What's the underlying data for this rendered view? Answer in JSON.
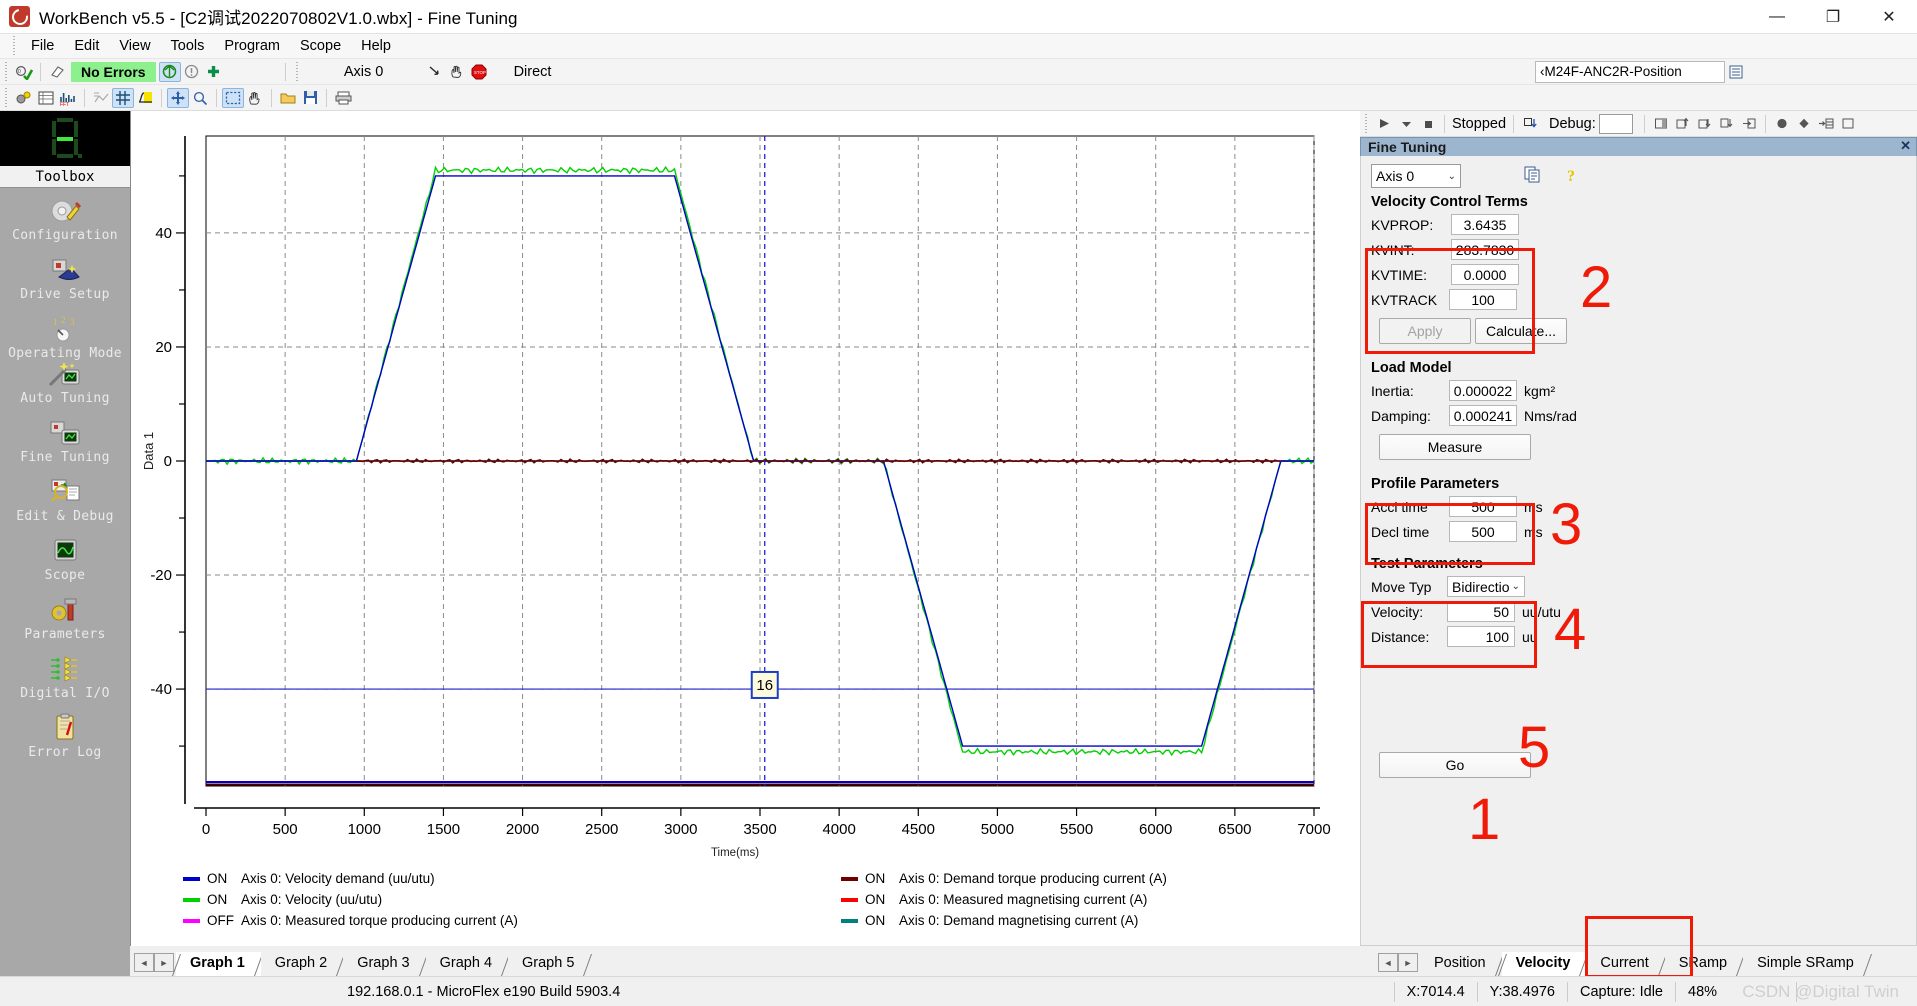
{
  "window": {
    "title": "WorkBench v5.5 - [C2调试2022070802V1.0.wbx] - Fine Tuning",
    "logo": "workbench-logo",
    "minimize": "—",
    "maximize": "❐",
    "close": "✕"
  },
  "menu": {
    "items": [
      "File",
      "Edit",
      "View",
      "Tools",
      "Program",
      "Scope",
      "Help"
    ]
  },
  "toolbar1": {
    "status_text": "No Errors",
    "axis_label": "Axis 0",
    "mode_label": "Direct",
    "config_value": "‹M24F-ANC2R-Position"
  },
  "debugbar": {
    "run_state": "Stopped",
    "debug_label": "Debug:"
  },
  "toolbox": {
    "title": "Toolbox",
    "items": [
      {
        "label": "Configuration",
        "icon": "gear-pencil-icon"
      },
      {
        "label": "Drive Setup",
        "icon": "wizard-hat-icon"
      },
      {
        "label": "Operating Mode",
        "icon": "numbers-dial-icon"
      },
      {
        "label": "Auto Tuning",
        "icon": "magic-wand-icon"
      },
      {
        "label": "Fine Tuning",
        "icon": "tuning-screen-icon"
      },
      {
        "label": "Edit & Debug",
        "icon": "magnifier-doc-icon"
      },
      {
        "label": "Scope",
        "icon": "oscilloscope-icon"
      },
      {
        "label": "Parameters",
        "icon": "hammer-gear-icon"
      },
      {
        "label": "Digital I/O",
        "icon": "io-signals-icon"
      },
      {
        "label": "Error Log",
        "icon": "clipboard-error-icon"
      }
    ]
  },
  "chart_data": {
    "type": "line",
    "title": "",
    "xlabel": "Time(ms)",
    "ylabel": "Data 1",
    "xlim": [
      0,
      7000
    ],
    "ylim": [
      -57,
      57
    ],
    "xticks": [
      0,
      500,
      1000,
      1500,
      2000,
      2500,
      3000,
      3500,
      4000,
      4500,
      5000,
      5500,
      6000,
      6500,
      7000
    ],
    "yticks": [
      40,
      20,
      0,
      -20,
      -40
    ],
    "grid": true,
    "legend_position": "bottom",
    "cursor": {
      "label": "16",
      "x": 3530
    },
    "threshold_line": {
      "value": -40,
      "color": "#2222cc"
    },
    "series": [
      {
        "name": "Axis 0: Velocity demand (uu/utu)",
        "state": "ON",
        "color": "#0000cc",
        "points": [
          [
            0,
            0
          ],
          [
            950,
            0
          ],
          [
            1450,
            50
          ],
          [
            2960,
            50
          ],
          [
            3460,
            0
          ],
          [
            4280,
            0
          ],
          [
            4780,
            -50
          ],
          [
            6290,
            -50
          ],
          [
            6790,
            0
          ],
          [
            7000,
            0
          ]
        ]
      },
      {
        "name": "Axis 0: Velocity (uu/utu)",
        "state": "ON",
        "color": "#00d000",
        "points": [
          [
            0,
            0
          ],
          [
            950,
            0
          ],
          [
            1450,
            51
          ],
          [
            2960,
            51
          ],
          [
            3460,
            0
          ],
          [
            4280,
            0
          ],
          [
            4780,
            -51
          ],
          [
            6290,
            -51
          ],
          [
            6790,
            0
          ],
          [
            7000,
            0
          ]
        ]
      },
      {
        "name": "Axis 0: Measured torque producing current (A)",
        "state": "OFF",
        "color": "#ff00ff",
        "points": []
      },
      {
        "name": "Axis 0: Demand torque producing current (A)",
        "state": "ON",
        "color": "#6e0000",
        "points": [
          [
            950,
            0
          ],
          [
            3460,
            0
          ],
          [
            4280,
            0
          ],
          [
            6790,
            0
          ]
        ]
      },
      {
        "name": "Axis 0: Measured magnetising current (A)",
        "state": "ON",
        "color": "#ff0000",
        "points": [
          [
            950,
            0
          ],
          [
            3460,
            0
          ],
          [
            4280,
            0
          ],
          [
            6790,
            0
          ]
        ]
      },
      {
        "name": "Axis 0: Demand magnetising current (A)",
        "state": "ON",
        "color": "#008080",
        "points": [
          [
            950,
            0
          ],
          [
            3460,
            0
          ],
          [
            4280,
            0
          ],
          [
            6790,
            0
          ]
        ]
      }
    ]
  },
  "graph_tabs": {
    "items": [
      "Graph 1",
      "Graph 2",
      "Graph 3",
      "Graph 4",
      "Graph 5"
    ],
    "selected": "Graph 1",
    "prev": "◄",
    "next": "►"
  },
  "fine_tuning": {
    "panel_title": "Fine Tuning",
    "panel_close": "✕",
    "axis_select": "Axis 0",
    "copy_icon": "copy-icon",
    "help_icon": "help-icon",
    "velocity_control": {
      "title": "Velocity Control Terms",
      "fields": [
        {
          "label": "KVPROP:",
          "value": "3.6435"
        },
        {
          "label": "KVINT:",
          "value": "283.7830"
        },
        {
          "label": "KVTIME:",
          "value": "0.0000"
        },
        {
          "label": "KVTRACK",
          "value": "100"
        }
      ],
      "apply_label": "Apply",
      "calculate_label": "Calculate..."
    },
    "load_model": {
      "title": "Load Model",
      "fields": [
        {
          "label": "Inertia:",
          "value": "0.000022",
          "unit": "kgm²"
        },
        {
          "label": "Damping:",
          "value": "0.000241",
          "unit": "Nms/rad"
        }
      ],
      "measure_label": "Measure"
    },
    "profile_parameters": {
      "title": "Profile Parameters",
      "fields": [
        {
          "label": "Accl time",
          "value": "500",
          "unit": "ms"
        },
        {
          "label": "Decl time",
          "value": "500",
          "unit": "ms"
        }
      ]
    },
    "test_parameters": {
      "title": "Test Parameters",
      "move_type_label": "Move Typ",
      "move_type_value": "Bidirectio",
      "fields": [
        {
          "label": "Velocity:",
          "value": "50",
          "unit": "uu/utu"
        },
        {
          "label": "Distance:",
          "value": "100",
          "unit": "uu"
        }
      ]
    },
    "go_label": "Go"
  },
  "annotations": {
    "numbers": [
      "1",
      "2",
      "3",
      "4",
      "5"
    ]
  },
  "mode_tabs": {
    "items": [
      "Position",
      "Velocity",
      "Current",
      "SRamp",
      "Simple SRamp"
    ],
    "selected": "Velocity",
    "prev": "◄",
    "next": "►"
  },
  "statusbar": {
    "connection": "192.168.0.1 - MicroFlex e190 Build 5903.4",
    "x_value": "X:7014.4",
    "y_value": "Y:38.4976",
    "capture": "Capture: Idle",
    "zoom": "48%",
    "watermark": "CSDN @Digital Twin"
  },
  "colors": {
    "highlight": "#f01a08",
    "status_ok_bg": "#8cf08c",
    "panel_header": "#9db6d0"
  }
}
